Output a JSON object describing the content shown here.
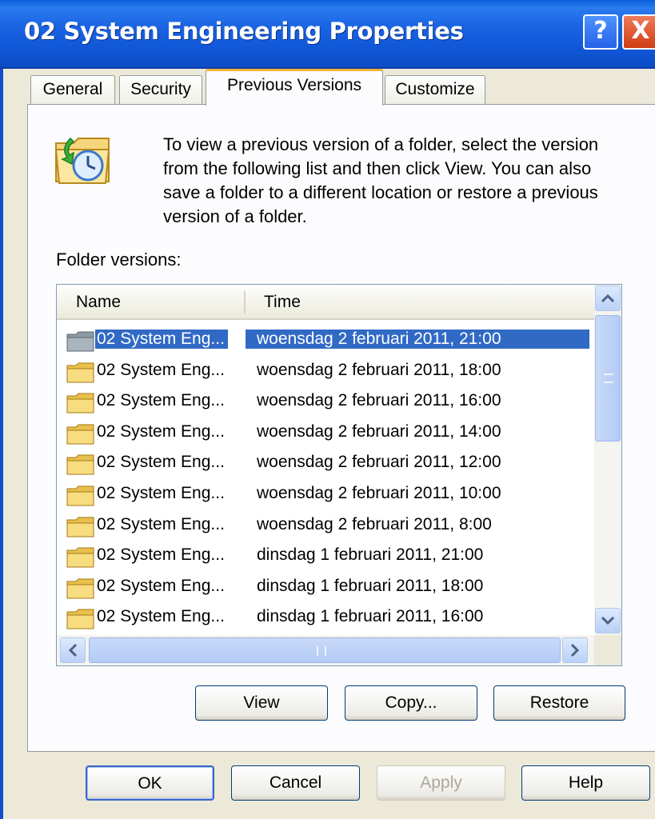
{
  "window": {
    "title": "02 System Engineering Properties",
    "help_glyph": "?",
    "close_glyph": "X"
  },
  "tabs": {
    "general": "General",
    "security": "Security",
    "previous_versions": "Previous Versions",
    "customize": "Customize",
    "active": "previous_versions"
  },
  "intro_text": "To view a previous version of a folder, select the version from the following list and then click View. You can also save a folder to a different location or restore a previous version of a folder.",
  "folder_versions_label": "Folder versions:",
  "list": {
    "columns": {
      "name": "Name",
      "time": "Time"
    },
    "rows": [
      {
        "name": "02 System Eng...",
        "time": "woensdag 2 februari 2011, 21:00",
        "selected": true
      },
      {
        "name": "02 System Eng...",
        "time": "woensdag 2 februari 2011, 18:00"
      },
      {
        "name": "02 System Eng...",
        "time": "woensdag 2 februari 2011, 16:00"
      },
      {
        "name": "02 System Eng...",
        "time": "woensdag 2 februari 2011, 14:00"
      },
      {
        "name": "02 System Eng...",
        "time": "woensdag 2 februari 2011, 12:00"
      },
      {
        "name": "02 System Eng...",
        "time": "woensdag 2 februari 2011, 10:00"
      },
      {
        "name": "02 System Eng...",
        "time": "woensdag 2 februari 2011, 8:00"
      },
      {
        "name": "02 System Eng...",
        "time": "dinsdag 1 februari 2011, 21:00"
      },
      {
        "name": "02 System Eng...",
        "time": "dinsdag 1 februari 2011, 18:00"
      },
      {
        "name": "02 System Eng...",
        "time": "dinsdag 1 februari 2011, 16:00"
      }
    ]
  },
  "buttons": {
    "view": "View",
    "copy": "Copy...",
    "restore": "Restore",
    "ok": "OK",
    "cancel": "Cancel",
    "apply": "Apply",
    "help": "Help"
  },
  "colors": {
    "titlebar": "#0f56d6",
    "selection": "#316ac5",
    "dialog_bg": "#ece9d8",
    "active_tab_accent": "#f2b23a"
  },
  "icons": {
    "folder": "folder-icon",
    "previous_versions": "folder-history-icon"
  }
}
